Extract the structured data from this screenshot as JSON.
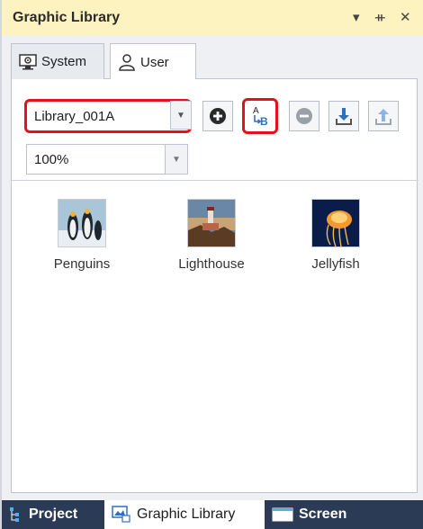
{
  "window": {
    "title": "Graphic Library",
    "controls": {
      "dropdown": "▾",
      "pin": "ᚑ",
      "close": "✕"
    }
  },
  "tabs": [
    {
      "label": "System",
      "icon": "monitor-gear-icon"
    },
    {
      "label": "User",
      "icon": "user-icon"
    }
  ],
  "toolbar": {
    "library_value": "Library_001A",
    "zoom_value": "100%",
    "buttons": [
      "add-icon",
      "rename-icon",
      "remove-icon",
      "import-icon",
      "export-icon"
    ],
    "rename_glyph_top": "A",
    "rename_glyph_bottom": "B"
  },
  "items": [
    {
      "label": "Penguins"
    },
    {
      "label": "Lighthouse"
    },
    {
      "label": "Jellyfish"
    }
  ],
  "bottom_tabs": [
    {
      "label": "Project"
    },
    {
      "label": "Graphic Library"
    },
    {
      "label": "Screen"
    }
  ],
  "colors": {
    "title_bar": "#fdf3c0",
    "highlight": "#e4101d",
    "accent_blue": "#2f6fc0",
    "bottom_bar": "#2b3a55"
  }
}
